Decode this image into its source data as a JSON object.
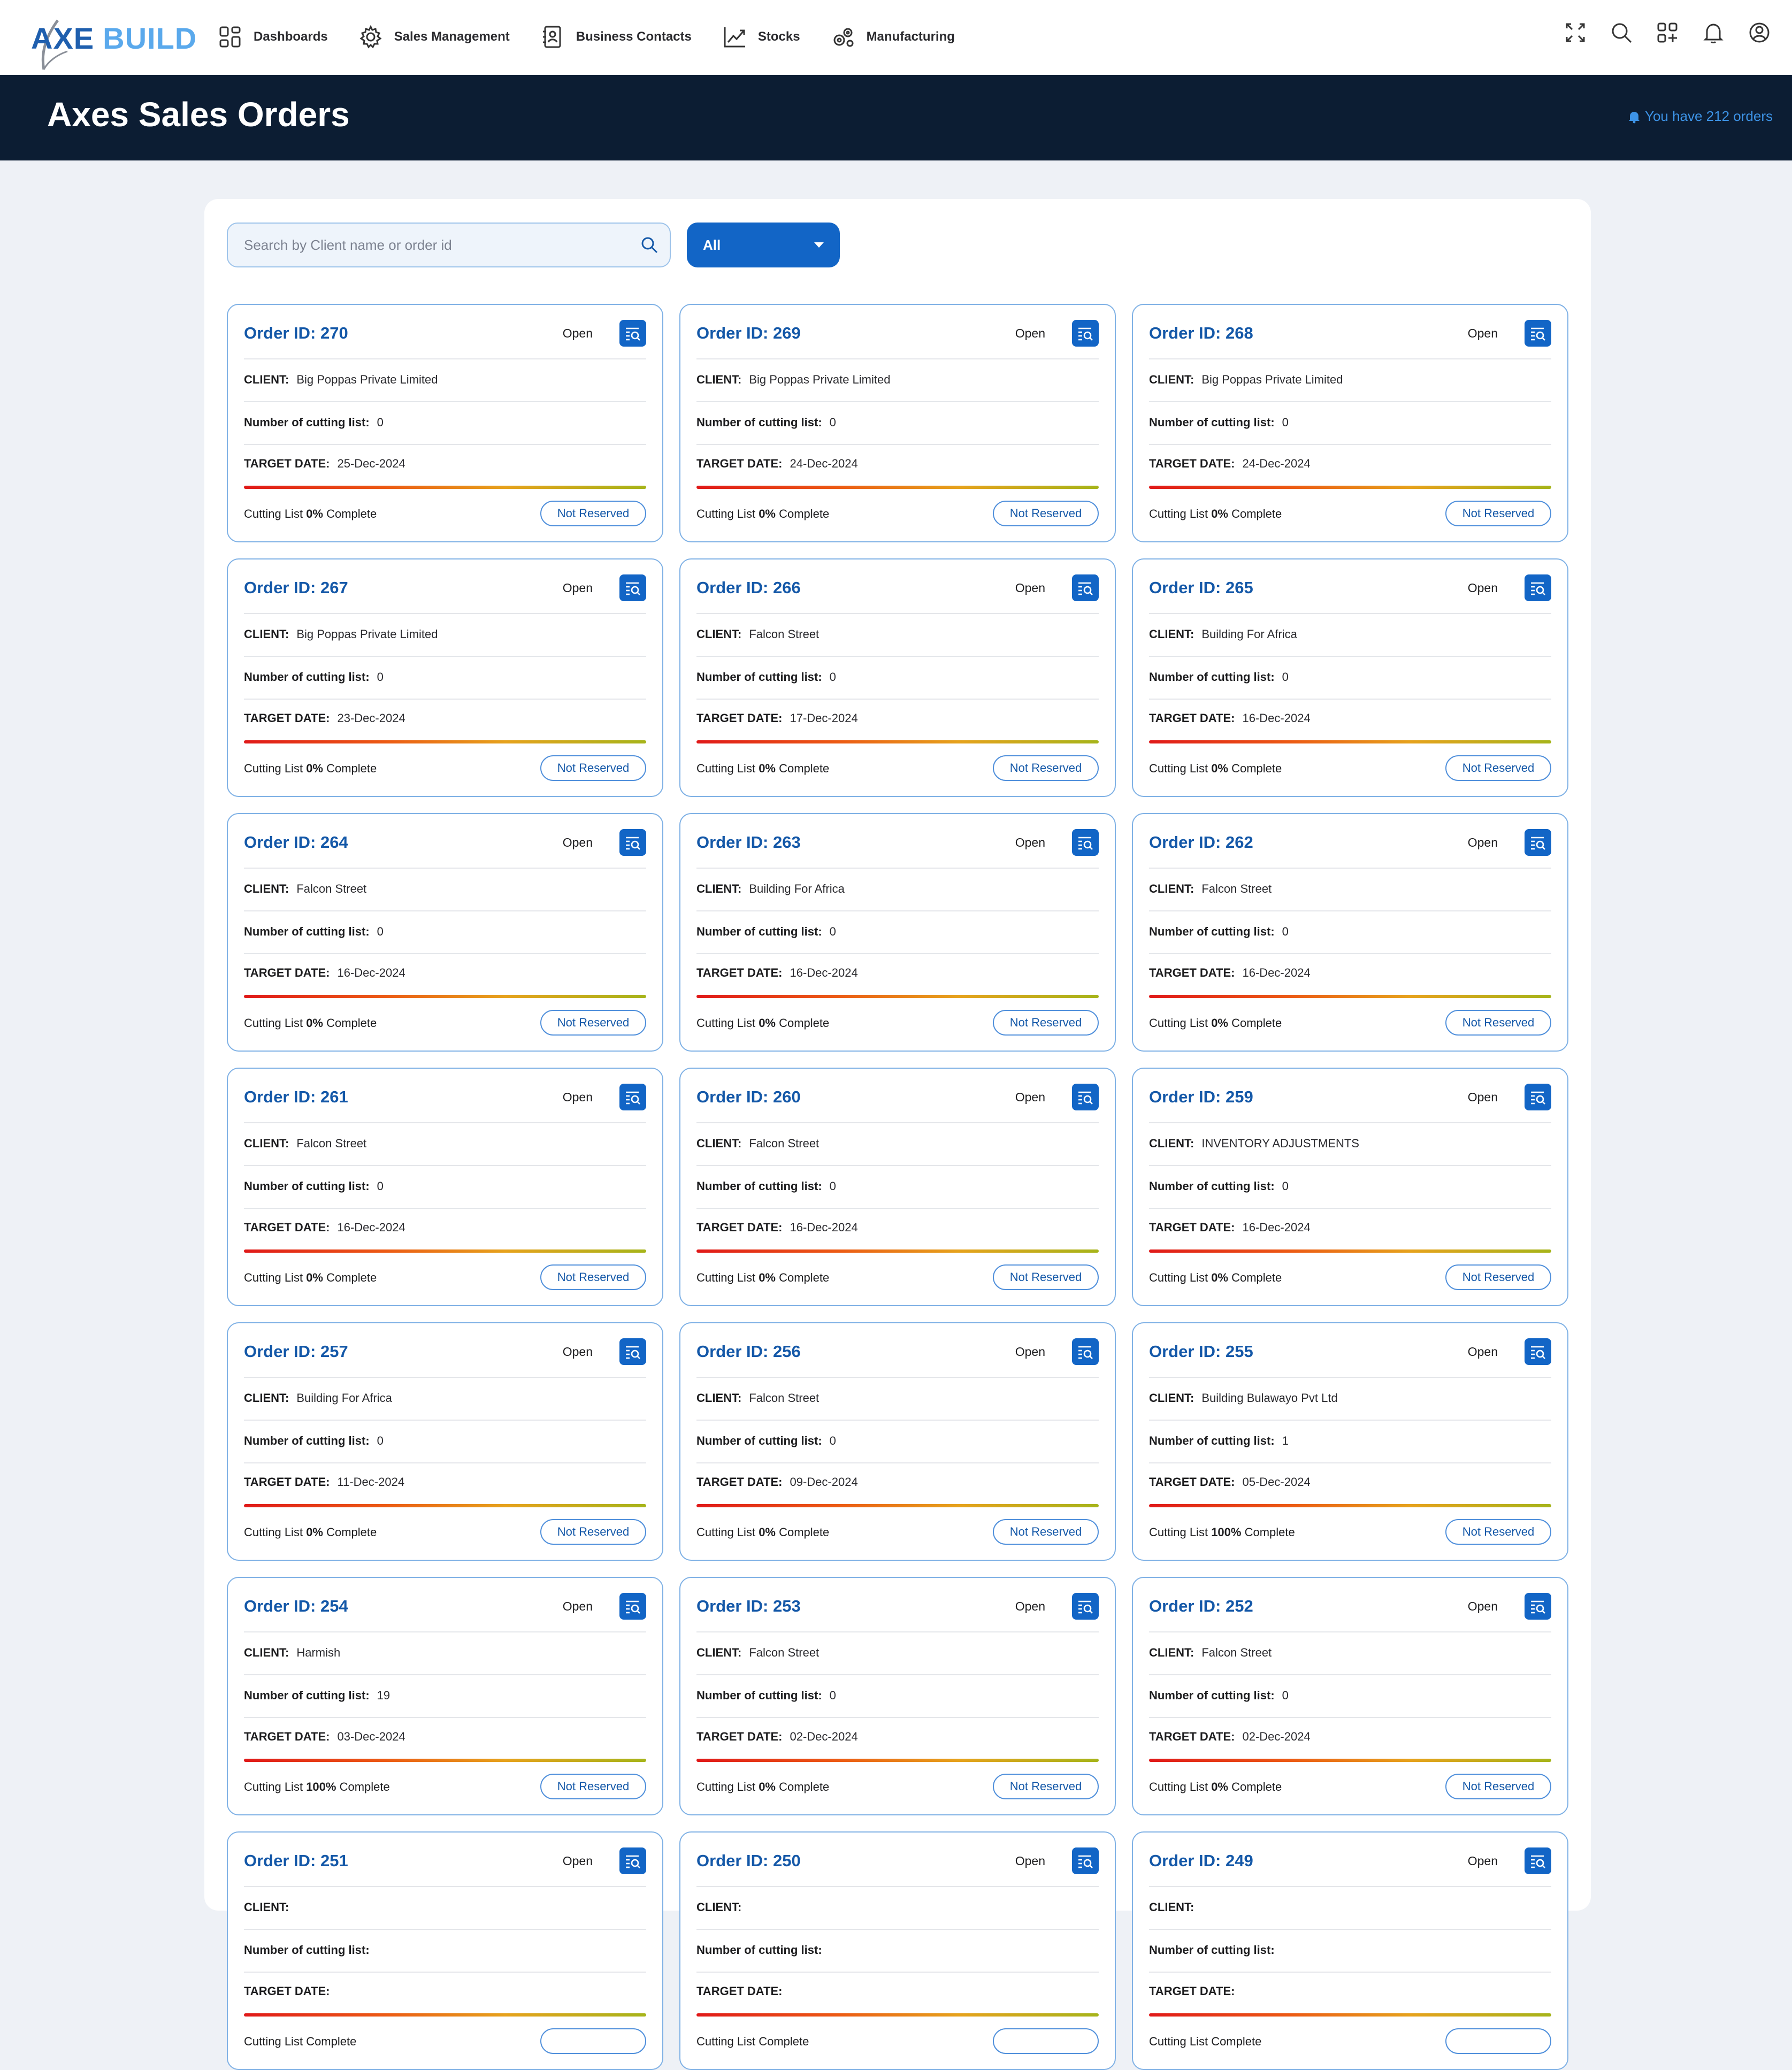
{
  "app": {
    "logo_axe": "AXE",
    "logo_build": "BUILD"
  },
  "nav": [
    {
      "label": "Dashboards",
      "icon": "grid-icon"
    },
    {
      "label": "Sales Management",
      "icon": "gear-icon"
    },
    {
      "label": "Business Contacts",
      "icon": "contacts-icon"
    },
    {
      "label": "Stocks",
      "icon": "trend-icon"
    },
    {
      "label": "Manufacturing",
      "icon": "cogs-icon"
    }
  ],
  "tools": [
    "fullscreen-icon",
    "search-icon",
    "apps-icon",
    "bell-icon",
    "user-icon"
  ],
  "header": {
    "title": "Axes Sales Orders",
    "orders_note": "You have 212 orders"
  },
  "search": {
    "placeholder": "Search by Client name or order id",
    "value": ""
  },
  "filter": {
    "selected": "All"
  },
  "labels": {
    "order_prefix": "Order ID: ",
    "client": "CLIENT:",
    "cutting": "Number of cutting list:",
    "target": "TARGET DATE:",
    "cutting_list_prefix": "Cutting List",
    "complete_suffix": "Complete",
    "reserve": "Not Reserved"
  },
  "colors": {
    "accent": "#1265c6",
    "header_bg": "#0c1d33",
    "card_border": "#7fb1e5"
  },
  "orders": [
    {
      "id": "270",
      "status": "Open",
      "client": "Big Poppas Private Limited",
      "cutting": "0",
      "target": "25-Dec-2024",
      "complete": "0%",
      "reserve": "Not Reserved"
    },
    {
      "id": "269",
      "status": "Open",
      "client": "Big Poppas Private Limited",
      "cutting": "0",
      "target": "24-Dec-2024",
      "complete": "0%",
      "reserve": "Not Reserved"
    },
    {
      "id": "268",
      "status": "Open",
      "client": "Big Poppas Private Limited",
      "cutting": "0",
      "target": "24-Dec-2024",
      "complete": "0%",
      "reserve": "Not Reserved"
    },
    {
      "id": "267",
      "status": "Open",
      "client": "Big Poppas Private Limited",
      "cutting": "0",
      "target": "23-Dec-2024",
      "complete": "0%",
      "reserve": "Not Reserved"
    },
    {
      "id": "266",
      "status": "Open",
      "client": "Falcon Street",
      "cutting": "0",
      "target": "17-Dec-2024",
      "complete": "0%",
      "reserve": "Not Reserved"
    },
    {
      "id": "265",
      "status": "Open",
      "client": "Building For Africa",
      "cutting": "0",
      "target": "16-Dec-2024",
      "complete": "0%",
      "reserve": "Not Reserved"
    },
    {
      "id": "264",
      "status": "Open",
      "client": "Falcon Street",
      "cutting": "0",
      "target": "16-Dec-2024",
      "complete": "0%",
      "reserve": "Not Reserved"
    },
    {
      "id": "263",
      "status": "Open",
      "client": "Building For Africa",
      "cutting": "0",
      "target": "16-Dec-2024",
      "complete": "0%",
      "reserve": "Not Reserved"
    },
    {
      "id": "262",
      "status": "Open",
      "client": "Falcon Street",
      "cutting": "0",
      "target": "16-Dec-2024",
      "complete": "0%",
      "reserve": "Not Reserved"
    },
    {
      "id": "261",
      "status": "Open",
      "client": "Falcon Street",
      "cutting": "0",
      "target": "16-Dec-2024",
      "complete": "0%",
      "reserve": "Not Reserved"
    },
    {
      "id": "260",
      "status": "Open",
      "client": "Falcon Street",
      "cutting": "0",
      "target": "16-Dec-2024",
      "complete": "0%",
      "reserve": "Not Reserved"
    },
    {
      "id": "259",
      "status": "Open",
      "client": "INVENTORY ADJUSTMENTS",
      "cutting": "0",
      "target": "16-Dec-2024",
      "complete": "0%",
      "reserve": "Not Reserved"
    },
    {
      "id": "257",
      "status": "Open",
      "client": "Building For Africa",
      "cutting": "0",
      "target": "11-Dec-2024",
      "complete": "0%",
      "reserve": "Not Reserved"
    },
    {
      "id": "256",
      "status": "Open",
      "client": "Falcon Street",
      "cutting": "0",
      "target": "09-Dec-2024",
      "complete": "0%",
      "reserve": "Not Reserved"
    },
    {
      "id": "255",
      "status": "Open",
      "client": "Building Bulawayo Pvt Ltd",
      "cutting": "1",
      "target": "05-Dec-2024",
      "complete": "100%",
      "reserve": "Not Reserved"
    },
    {
      "id": "254",
      "status": "Open",
      "client": "Harmish",
      "cutting": "19",
      "target": "03-Dec-2024",
      "complete": "100%",
      "reserve": "Not Reserved"
    },
    {
      "id": "253",
      "status": "Open",
      "client": "Falcon Street",
      "cutting": "0",
      "target": "02-Dec-2024",
      "complete": "0%",
      "reserve": "Not Reserved"
    },
    {
      "id": "252",
      "status": "Open",
      "client": "Falcon Street",
      "cutting": "0",
      "target": "02-Dec-2024",
      "complete": "0%",
      "reserve": "Not Reserved"
    },
    {
      "id": "251",
      "status": "Open",
      "client": "",
      "cutting": "",
      "target": "",
      "complete": "",
      "reserve": ""
    },
    {
      "id": "250",
      "status": "Open",
      "client": "",
      "cutting": "",
      "target": "",
      "complete": "",
      "reserve": ""
    },
    {
      "id": "249",
      "status": "Open",
      "client": "",
      "cutting": "",
      "target": "",
      "complete": "",
      "reserve": ""
    }
  ]
}
